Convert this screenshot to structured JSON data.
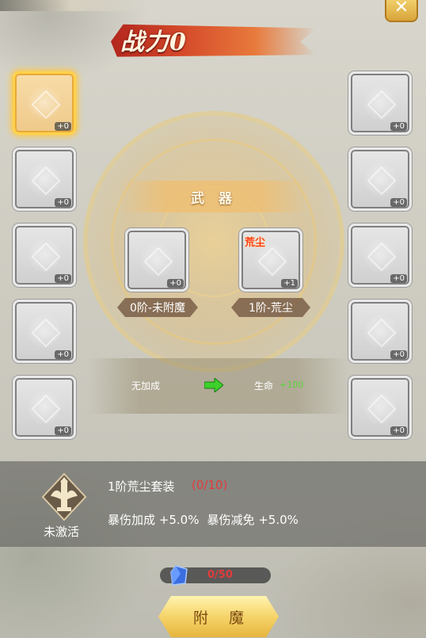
{
  "header": {
    "combat_power_label": "战力0",
    "close_icon": "close-x-icon"
  },
  "center": {
    "category_label": "武 器",
    "current_slot": {
      "level": "+0",
      "stage_label": "0阶-未附魔"
    },
    "next_slot": {
      "name": "荒尘",
      "level": "+1",
      "stage_label": "1阶-荒尘"
    }
  },
  "left_slots": [
    {
      "level": "+0",
      "selected": true
    },
    {
      "level": "+0"
    },
    {
      "level": "+0"
    },
    {
      "level": "+0"
    },
    {
      "level": "+0"
    }
  ],
  "right_slots": [
    {
      "level": "+0"
    },
    {
      "level": "+0"
    },
    {
      "level": "+0"
    },
    {
      "level": "+0"
    },
    {
      "level": "+0"
    }
  ],
  "bonus": {
    "before": "无加成",
    "after_stat": "生命",
    "after_value": "+100"
  },
  "set_bonus": {
    "status": "未激活",
    "title": "1阶荒尘套装",
    "progress": "(0/10)",
    "effects": [
      "暴伤加成 +5.0%",
      "暴伤减免 +5.0%"
    ]
  },
  "material": {
    "count": "0/50",
    "icon": "blue-gem-icon"
  },
  "actions": {
    "enchant_label": "附 魔"
  },
  "colors": {
    "highlight": "#ffd24a",
    "negative": "#e23b3b",
    "positive": "#5bd43a"
  }
}
